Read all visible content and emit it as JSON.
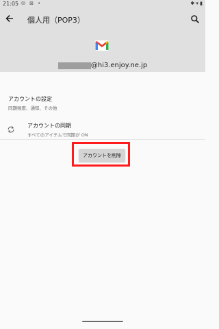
{
  "status_bar": {
    "time": "21:05",
    "left_icons": "✉ ⊠ •",
    "right_icons": "✱ ▾ ▮"
  },
  "header": {
    "title": "個人用（POP3）"
  },
  "account": {
    "email_domain": "@hi3.enjoy.ne.jp"
  },
  "settings": {
    "account_settings_title": "アカウントの設定",
    "account_settings_sub": "同期頻度、通知、その他",
    "sync_title": "アカウントの同期",
    "sync_sub": "すべてのアイテムで同期が ON"
  },
  "actions": {
    "delete_account": "アカウントを削除"
  },
  "colors": {
    "highlight": "#ff1b1b",
    "header_bg": "#e0e0e0"
  }
}
